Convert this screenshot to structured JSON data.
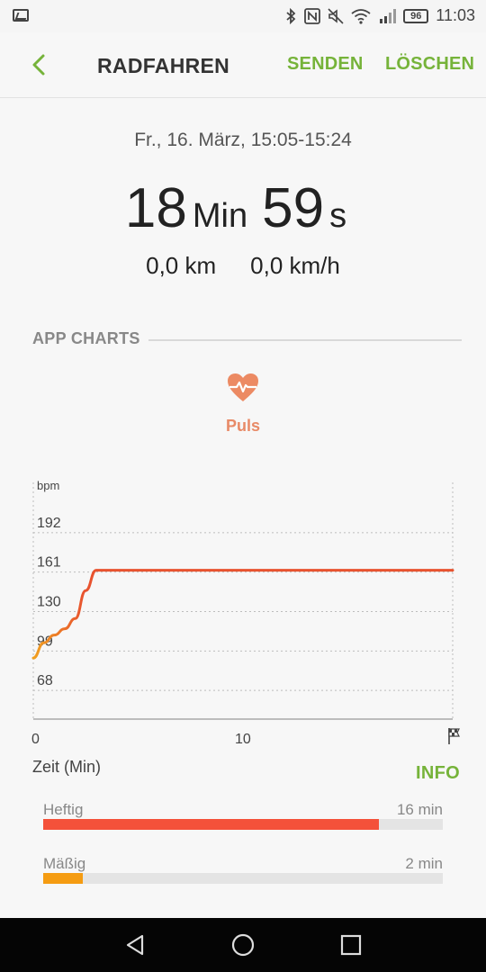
{
  "status": {
    "time": "11:03",
    "battery": "96",
    "icons": [
      "gallery-icon",
      "bluetooth-icon",
      "nfc-icon",
      "mute-icon",
      "wifi-icon",
      "signal-icon"
    ]
  },
  "appbar": {
    "title": "RADFAHREN",
    "send_label": "SENDEN",
    "delete_label": "LÖSCHEN"
  },
  "summary": {
    "date": "Fr., 16. März, 15:05-15:24",
    "minutes": "18",
    "minutes_unit": "Min",
    "seconds": "59",
    "seconds_unit": "s",
    "distance": "0,0 km",
    "speed": "0,0 km/h"
  },
  "section": {
    "title": "APP CHARTS",
    "pulse_label": "Puls"
  },
  "chart_data": {
    "type": "line",
    "ylabel": "bpm",
    "xlabel": "Zeit (Min)",
    "yticks": [
      192,
      161,
      130,
      99,
      68
    ],
    "xticks": [
      0,
      10
    ],
    "ylim": [
      37,
      223
    ],
    "xlim": [
      0,
      20
    ],
    "grid": true,
    "series": [
      {
        "x": [
          0,
          0.5,
          1,
          1.5,
          2,
          2.5,
          3,
          4,
          6,
          8,
          10,
          12,
          14,
          16,
          18,
          20
        ],
        "y": [
          85,
          97,
          103,
          108,
          116,
          138,
          154,
          154,
          154,
          154,
          154,
          154,
          154,
          154,
          154,
          154
        ]
      }
    ],
    "colors": {
      "low": "#f0a020",
      "high": "#e8532f",
      "grid": "#bdbdbd"
    }
  },
  "zones": {
    "time_label": "Zeit (Min)",
    "info_label": "INFO",
    "items": [
      {
        "label": "Heftig",
        "value": "16 min",
        "fraction": 0.84,
        "color": "#f4513a"
      },
      {
        "label": "Mäßig",
        "value": "2 min",
        "fraction": 0.1,
        "color": "#f59c12"
      }
    ]
  },
  "accent": "#76b33a"
}
